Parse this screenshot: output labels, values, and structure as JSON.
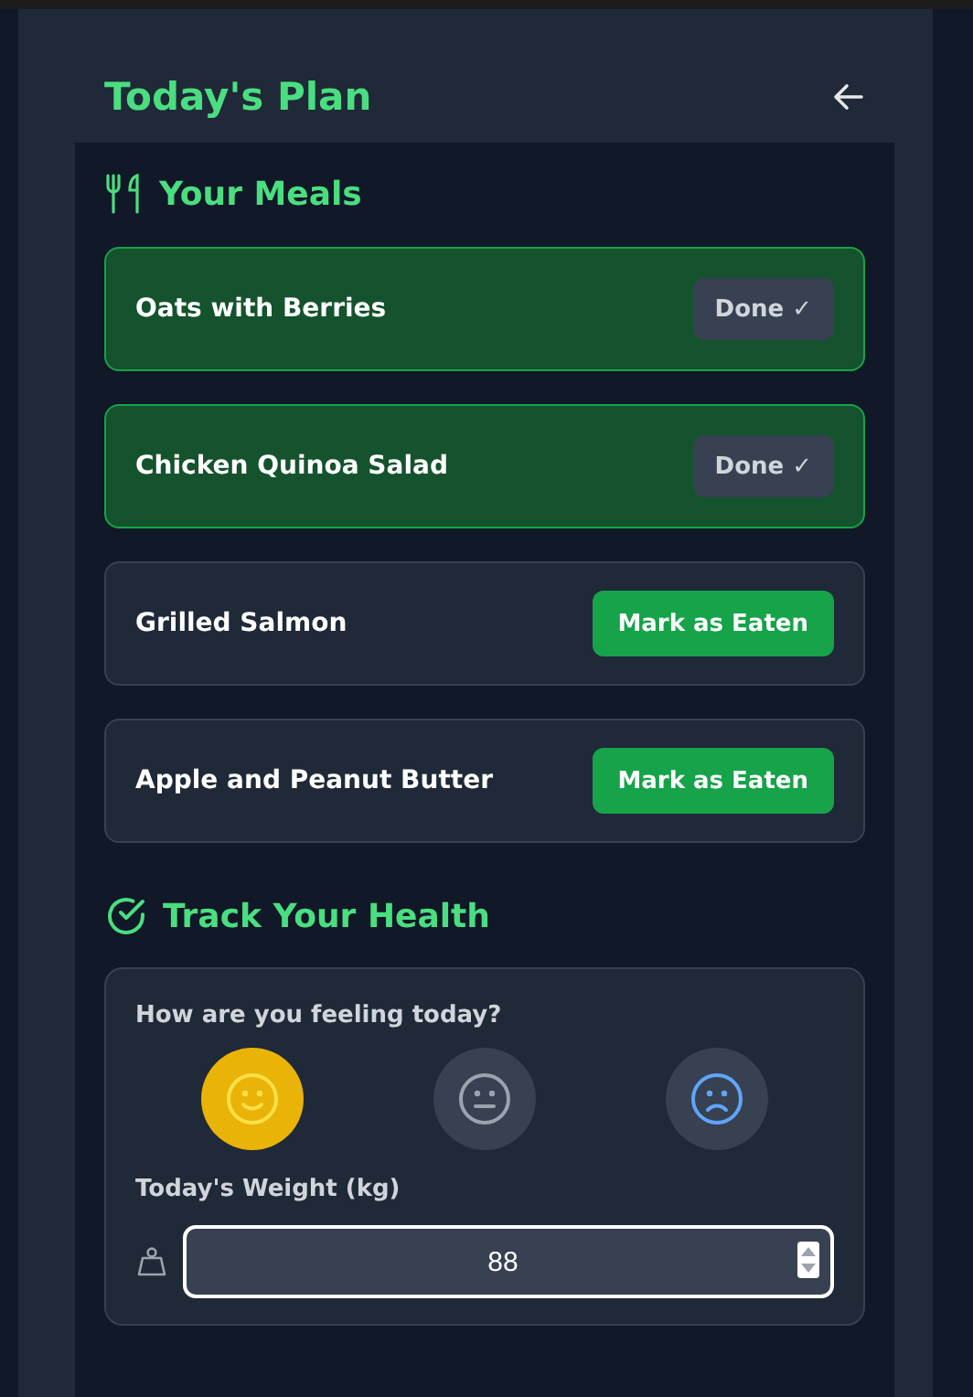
{
  "header": {
    "title": "Today's Plan"
  },
  "meals_section": {
    "title": "Your Meals"
  },
  "meals": [
    {
      "name": "Oats with Berries",
      "done": true,
      "button": "Done ✓"
    },
    {
      "name": "Chicken Quinoa Salad",
      "done": true,
      "button": "Done ✓"
    },
    {
      "name": "Grilled Salmon",
      "done": false,
      "button": "Mark as Eaten"
    },
    {
      "name": "Apple and Peanut Butter",
      "done": false,
      "button": "Mark as Eaten"
    }
  ],
  "health_section": {
    "title": "Track Your Health"
  },
  "feeling": {
    "label": "How are you feeling today?",
    "moods": [
      {
        "kind": "happy",
        "selected": true
      },
      {
        "kind": "neutral",
        "selected": false
      },
      {
        "kind": "sad",
        "selected": false
      }
    ]
  },
  "weight": {
    "label": "Today's Weight (kg)",
    "value": "88"
  }
}
